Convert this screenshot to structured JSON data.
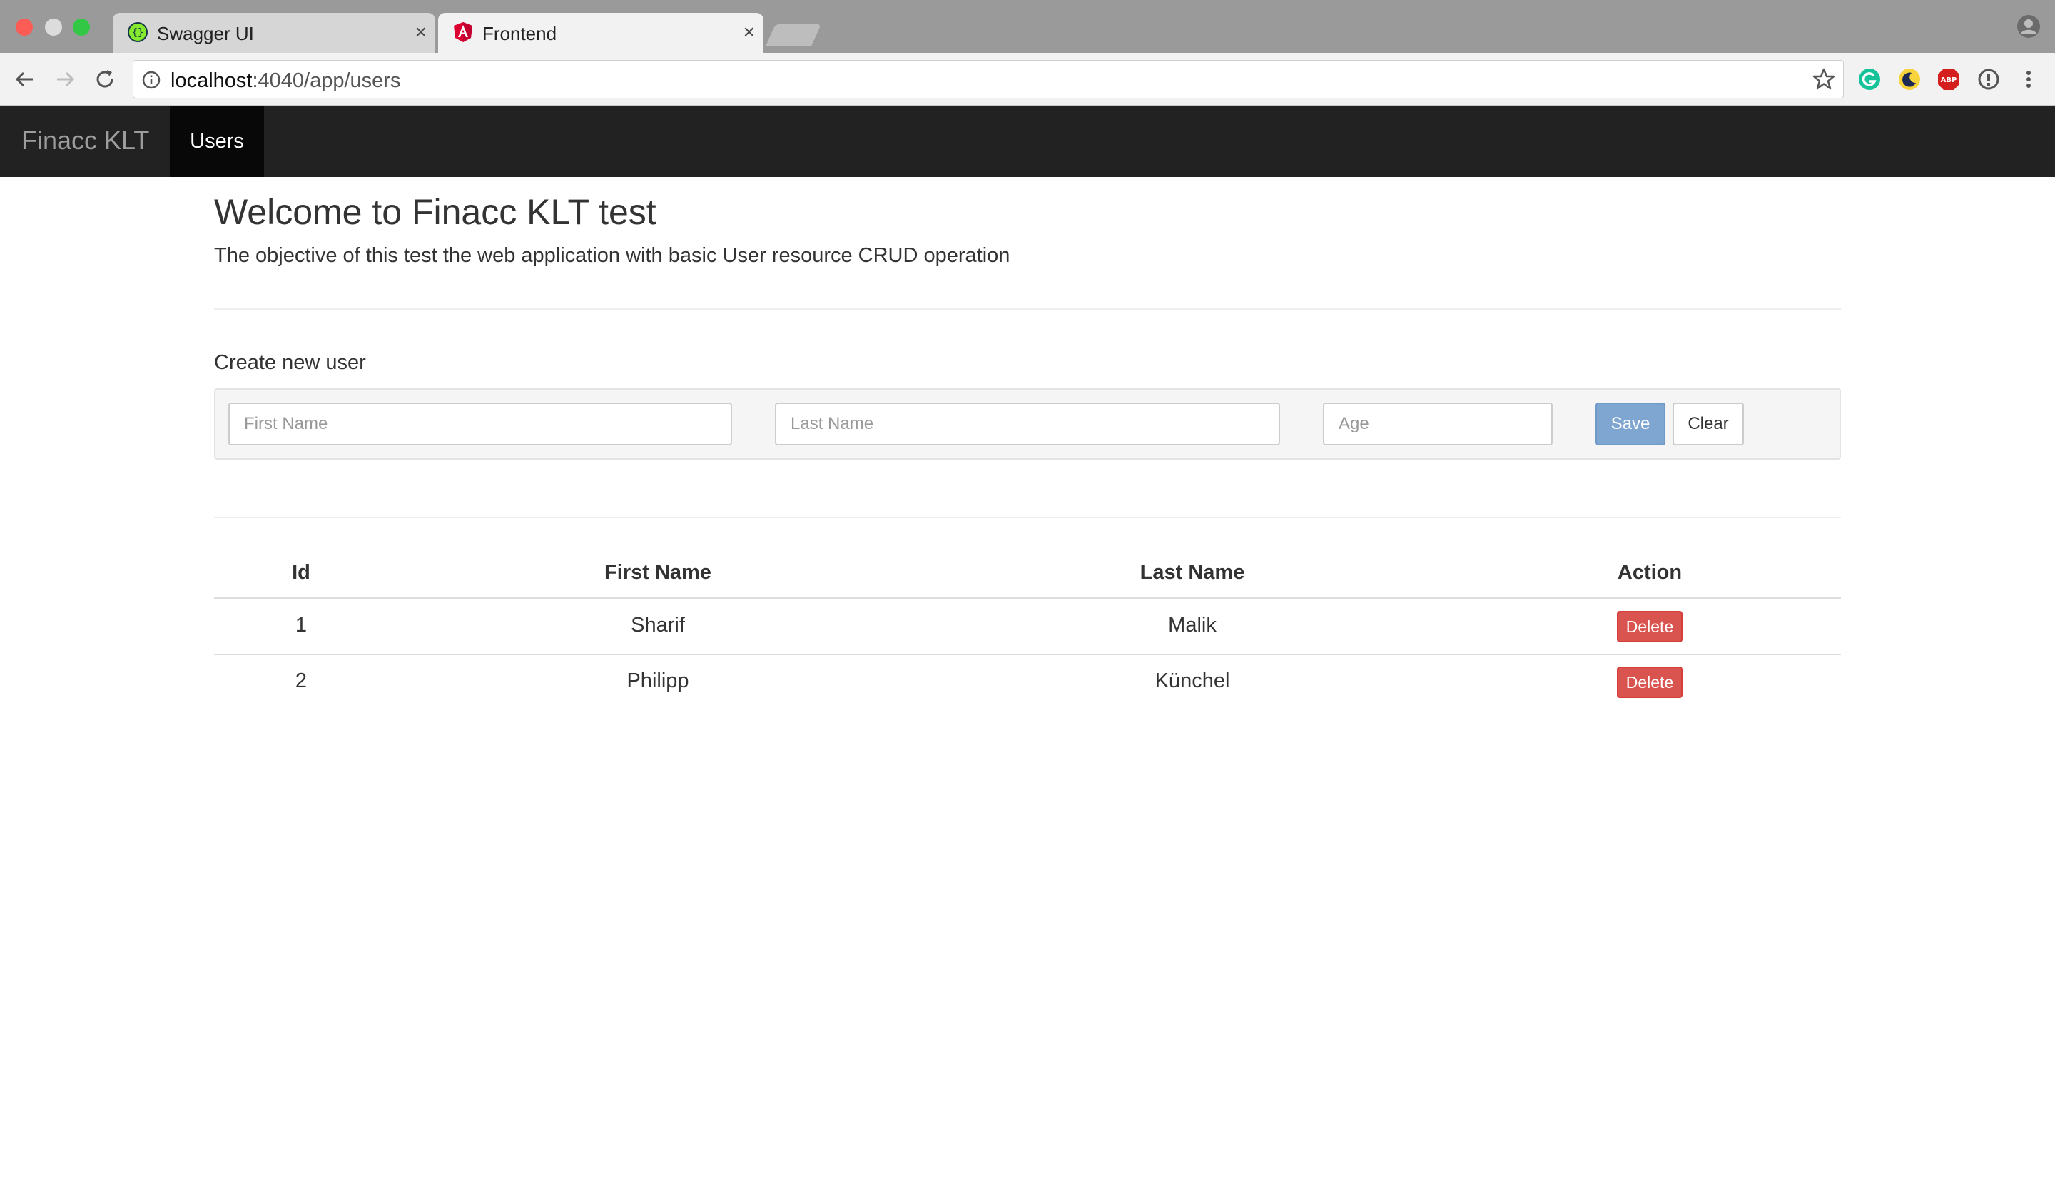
{
  "browser": {
    "tabs": [
      {
        "title": "Swagger UI",
        "icon": "swagger-icon",
        "active": false
      },
      {
        "title": "Frontend",
        "icon": "angular-icon",
        "active": true
      }
    ],
    "close_glyph": "×",
    "url_host": "localhost",
    "url_path": ":4040/app/users",
    "extensions": [
      "grammarly-icon",
      "night-mode-icon",
      "adblock-plus-icon",
      "privacy-icon",
      "menu-icon"
    ]
  },
  "navbar": {
    "brand": "Finacc KLT",
    "active_item": "Users"
  },
  "page": {
    "title": "Welcome to Finacc KLT test",
    "subtitle": "The objective of this test the web application with basic User resource CRUD operation"
  },
  "form": {
    "label": "Create new user",
    "first_name_placeholder": "First Name",
    "last_name_placeholder": "Last Name",
    "age_placeholder": "Age",
    "save_label": "Save",
    "clear_label": "Clear"
  },
  "table": {
    "headers": [
      "Id",
      "First Name",
      "Last Name",
      "Action"
    ],
    "rows": [
      {
        "id": "1",
        "first_name": "Sharif",
        "last_name": "Malik",
        "action": "Delete"
      },
      {
        "id": "2",
        "first_name": "Philipp",
        "last_name": "Künchel",
        "action": "Delete"
      }
    ]
  },
  "colors": {
    "navbar_bg": "#222222",
    "active_nav_bg": "#080808",
    "primary_button": "#7ea6d1",
    "danger_button": "#d9534f"
  }
}
